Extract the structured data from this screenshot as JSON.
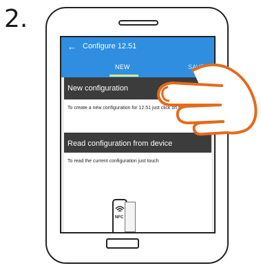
{
  "step": "2.",
  "app": {
    "back_icon": "back-arrow-icon",
    "title": "Configure 12.51"
  },
  "tabs": [
    {
      "label": "NEW",
      "selected": true
    },
    {
      "label": "SAVED",
      "selected": false
    }
  ],
  "cards": [
    {
      "header": "New configuration",
      "body": "To create a new configuration for 12.51 just click on the button on"
    },
    {
      "header": "Read configuration from device",
      "body": "To read the current configuration just touch"
    }
  ],
  "nfc_label": "NFC",
  "colors": {
    "appbar": "#2f8ee0",
    "tab_indicator": "#d7ec8c",
    "card_header": "#3c3c3c",
    "hand_outline": "#e46a1c"
  }
}
